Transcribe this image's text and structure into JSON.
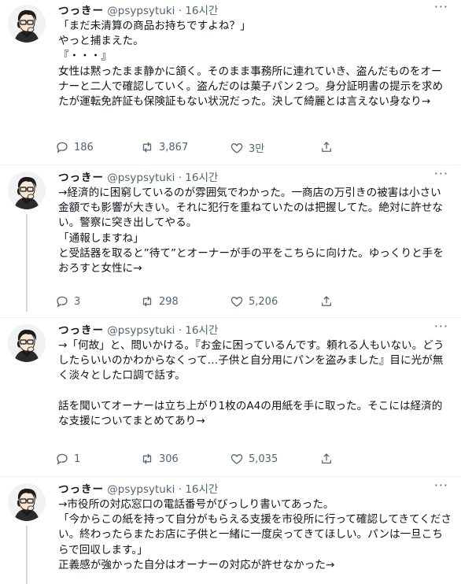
{
  "tweets": [
    {
      "name": "つっきー",
      "handle": "@psypsytuki",
      "dot": "·",
      "time": "16시간",
      "text": "「まだ未清算の商品お持ちですよね？」\nやっと捕まえた。\n『・・・』\n女性は黙ったまま静かに頷く。そのまま事務所に連れていき、盗んだものをオーナーと二人で確認していく。盗んだのは菓子パン２つ。身分証明書の提示を求めたが運転免許証も保険証もない状況だった。決して綺麗とは言えない身なり→",
      "replies": "186",
      "retweets": "3,867",
      "likes": "3만"
    },
    {
      "name": "つっきー",
      "handle": "@psypsytuki",
      "dot": "·",
      "time": "16시간",
      "text": "→経済的に困窮しているのが雰囲気でわかった。一商店の万引きの被害は小さい金額でも影響が大きい。それに犯行を重ねていたのは把握してた。絶対に許せない。警察に突き出してやる。\n「通報しますね」\nと受話器を取ると”待て”とオーナーが手の平をこちらに向けた。ゆっくりと手をおろすと女性に→",
      "replies": "3",
      "retweets": "298",
      "likes": "5,206"
    },
    {
      "name": "つっきー",
      "handle": "@psypsytuki",
      "dot": "·",
      "time": "16시간",
      "text": "→「何故」と、問いかける。『お金に困っているんです。頼れる人もいない。どうしたらいいのかわからなくって…子供と自分用にパンを盗みました』目に光が無く淡々とした口調で話す。\n\n話を聞いてオーナーは立ち上がり1枚のA4の用紙を手に取った。そこには経済的な支援についてまとめてあり→",
      "replies": "1",
      "retweets": "306",
      "likes": "5,035"
    },
    {
      "name": "つっきー",
      "handle": "@psypsytuki",
      "dot": "·",
      "time": "16시간",
      "text": "→市役所の対応窓口の電話番号がびっしり書いてあった。\n「今からこの紙を持って自分がもらえる支援を市役所に行って確認してきてください。終わったらまたお店に子供と一緒に一度戻ってきてほしい。パンは一旦こちらで回収します。」\n正義感が強かった自分はオーナーの対応が許せなかった→",
      "replies": "",
      "retweets": "",
      "likes": ""
    }
  ],
  "icons": {
    "more": "more-horizontal-icon",
    "reply": "reply-bubble-icon",
    "retweet": "retweet-arrows-icon",
    "like": "heart-icon",
    "share": "share-arrow-up-icon"
  },
  "colors": {
    "text": "#0f1419",
    "secondary": "#536471",
    "thread_line": "#cfd9de",
    "separator": "#eff3f4"
  }
}
